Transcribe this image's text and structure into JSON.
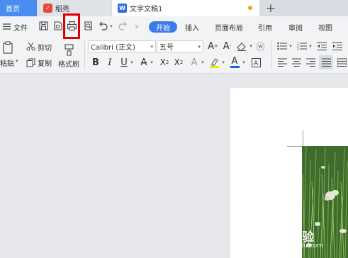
{
  "tabs": {
    "home": "首页",
    "daoke": "稻壳",
    "doc": "文字文稿1",
    "add": "+"
  },
  "menu": {
    "file": "文件",
    "start": "开始",
    "items": [
      "插入",
      "页面布局",
      "引用",
      "审阅",
      "视图"
    ]
  },
  "ribbon": {
    "cut": "剪切",
    "copy": "复制",
    "paste": "粘贴",
    "format_painter": "格式刷",
    "font_name": "Calibri (正文)",
    "font_size": "五号"
  },
  "watermark": {
    "text": "Bai 经验",
    "sub": "jingyan.baidu.com"
  },
  "colors": {
    "accent": "#3b7be9",
    "home_tab": "#4a8cf0",
    "highlight": "#e00000"
  }
}
